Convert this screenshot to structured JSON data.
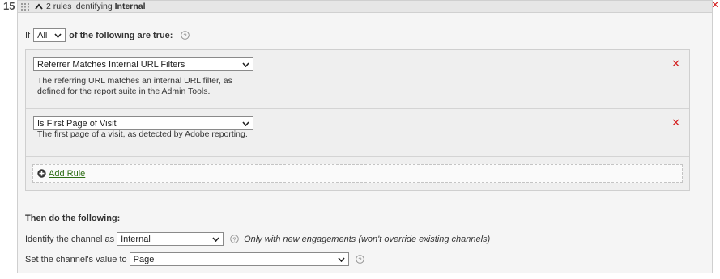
{
  "row_number": "15",
  "header": {
    "title_prefix": "2 rules identifying",
    "title_bold": "Internal"
  },
  "condition": {
    "if_label": "If",
    "mode_value": "All",
    "suffix": "of the following are true:"
  },
  "rules": [
    {
      "selected": "Referrer Matches Internal URL Filters",
      "description_line1": "The referring URL matches an internal URL filter, as",
      "description_line2": "defined for the report suite in the Admin Tools."
    },
    {
      "selected": "Is First Page of Visit",
      "description_line1": "The first page of a visit, as detected by Adobe reporting."
    }
  ],
  "add_rule_label": "Add Rule",
  "then": {
    "heading": "Then do the following:",
    "identify_label": "Identify the channel as",
    "channel_value": "Internal",
    "channel_note": "Only with new engagements (won't override existing channels)",
    "value_label": "Set the channel's value to",
    "value_selected": "Page"
  },
  "colors": {
    "remove": "#d42020",
    "link": "#2d6e14",
    "panel_bg": "#f5f5f5"
  }
}
